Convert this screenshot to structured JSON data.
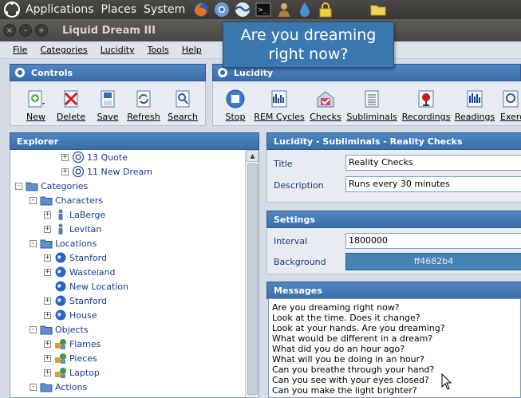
{
  "top_panel": {
    "menus": [
      "Applications",
      "Places",
      "System"
    ],
    "icons": [
      "ubuntu-logo-icon",
      "firefox-icon",
      "chromium-icon",
      "wave-icon",
      "terminal-icon",
      "user-icon",
      "water-drop-icon",
      "lock-icon",
      "folder-icon"
    ]
  },
  "window": {
    "title": "Liquid Dream III",
    "buttons": [
      "close",
      "minimize",
      "maximize"
    ]
  },
  "tooltip": {
    "text": "Are you dreaming right now?"
  },
  "menubar": {
    "items": [
      "File",
      "Categories",
      "Lucidity",
      "Tools",
      "Help"
    ]
  },
  "controls": {
    "title": "Controls",
    "buttons": [
      {
        "label": "New",
        "icon": "new-icon"
      },
      {
        "label": "Delete",
        "icon": "delete-icon"
      },
      {
        "label": "Save",
        "icon": "save-icon"
      },
      {
        "label": "Refresh",
        "icon": "refresh-icon"
      },
      {
        "label": "Search",
        "icon": "search-icon"
      }
    ]
  },
  "lucidity": {
    "title": "Lucidity",
    "buttons": [
      {
        "label": "Stop",
        "icon": "stop-icon"
      },
      {
        "label": "REM Cycles",
        "icon": "rem-cycles-icon"
      },
      {
        "label": "Checks",
        "icon": "checks-icon"
      },
      {
        "label": "Subliminals",
        "icon": "subliminals-icon"
      },
      {
        "label": "Recordings",
        "icon": "recordings-icon"
      },
      {
        "label": "Readings",
        "icon": "readings-icon"
      },
      {
        "label": "Exerc",
        "icon": "exercises-icon"
      }
    ]
  },
  "explorer": {
    "title": "Explorer",
    "rows": [
      {
        "label": "13 Quote",
        "icon": "dream-icon",
        "indent": 3,
        "expander": "+"
      },
      {
        "label": "11 New Dream",
        "icon": "dream-icon",
        "indent": 3,
        "expander": "+"
      },
      {
        "label": "Categories",
        "icon": "folder-icon",
        "indent": 0,
        "expander": "-"
      },
      {
        "label": "Characters",
        "icon": "folder-icon",
        "indent": 1,
        "expander": "-"
      },
      {
        "label": "LaBerge",
        "icon": "person-icon",
        "indent": 2,
        "expander": "+"
      },
      {
        "label": "Levitan",
        "icon": "person-icon",
        "indent": 2,
        "expander": "+"
      },
      {
        "label": "Locations",
        "icon": "folder-icon",
        "indent": 1,
        "expander": "-"
      },
      {
        "label": "Stanford",
        "icon": "globe-icon",
        "indent": 2,
        "expander": "+"
      },
      {
        "label": "Wasteland",
        "icon": "globe-icon",
        "indent": 2,
        "expander": "+"
      },
      {
        "label": "New Location",
        "icon": "globe-icon",
        "indent": 2,
        "expander": ""
      },
      {
        "label": "Stanford",
        "icon": "globe-icon",
        "indent": 2,
        "expander": "+"
      },
      {
        "label": "House",
        "icon": "globe-icon",
        "indent": 2,
        "expander": "+"
      },
      {
        "label": "Objects",
        "icon": "folder-icon",
        "indent": 1,
        "expander": "-"
      },
      {
        "label": "Flames",
        "icon": "objects-icon",
        "indent": 2,
        "expander": "+"
      },
      {
        "label": "Pieces",
        "icon": "objects-icon",
        "indent": 2,
        "expander": "+"
      },
      {
        "label": "Laptop",
        "icon": "objects-icon",
        "indent": 2,
        "expander": "+"
      },
      {
        "label": "Actions",
        "icon": "folder-icon",
        "indent": 1,
        "expander": "-"
      }
    ]
  },
  "detail": {
    "title": "Lucidity - Subliminals - Reality Checks",
    "title_label": "Title",
    "title_value": "Reality Checks",
    "description_label": "Description",
    "description_value": "Runs every 30 minutes"
  },
  "settings": {
    "title": "Settings",
    "interval_label": "Interval",
    "interval_value": "1800000",
    "background_label": "Background",
    "background_value": "ff4682b4"
  },
  "messages": {
    "title": "Messages",
    "lines": [
      "Are you dreaming right now?",
      "Look at the time. Does it change?",
      "Look at your hands. Are you dreaming?",
      "What would be different in a dream?",
      "What did you do an hour ago?",
      "What will you be doing in an hour?",
      "Can you breathe through your hand?",
      "Can you see with your eyes closed?",
      "Can you make the light brighter?"
    ]
  },
  "colors": {
    "header_blue": "#3a6ea8",
    "accent": "#4682b4"
  }
}
